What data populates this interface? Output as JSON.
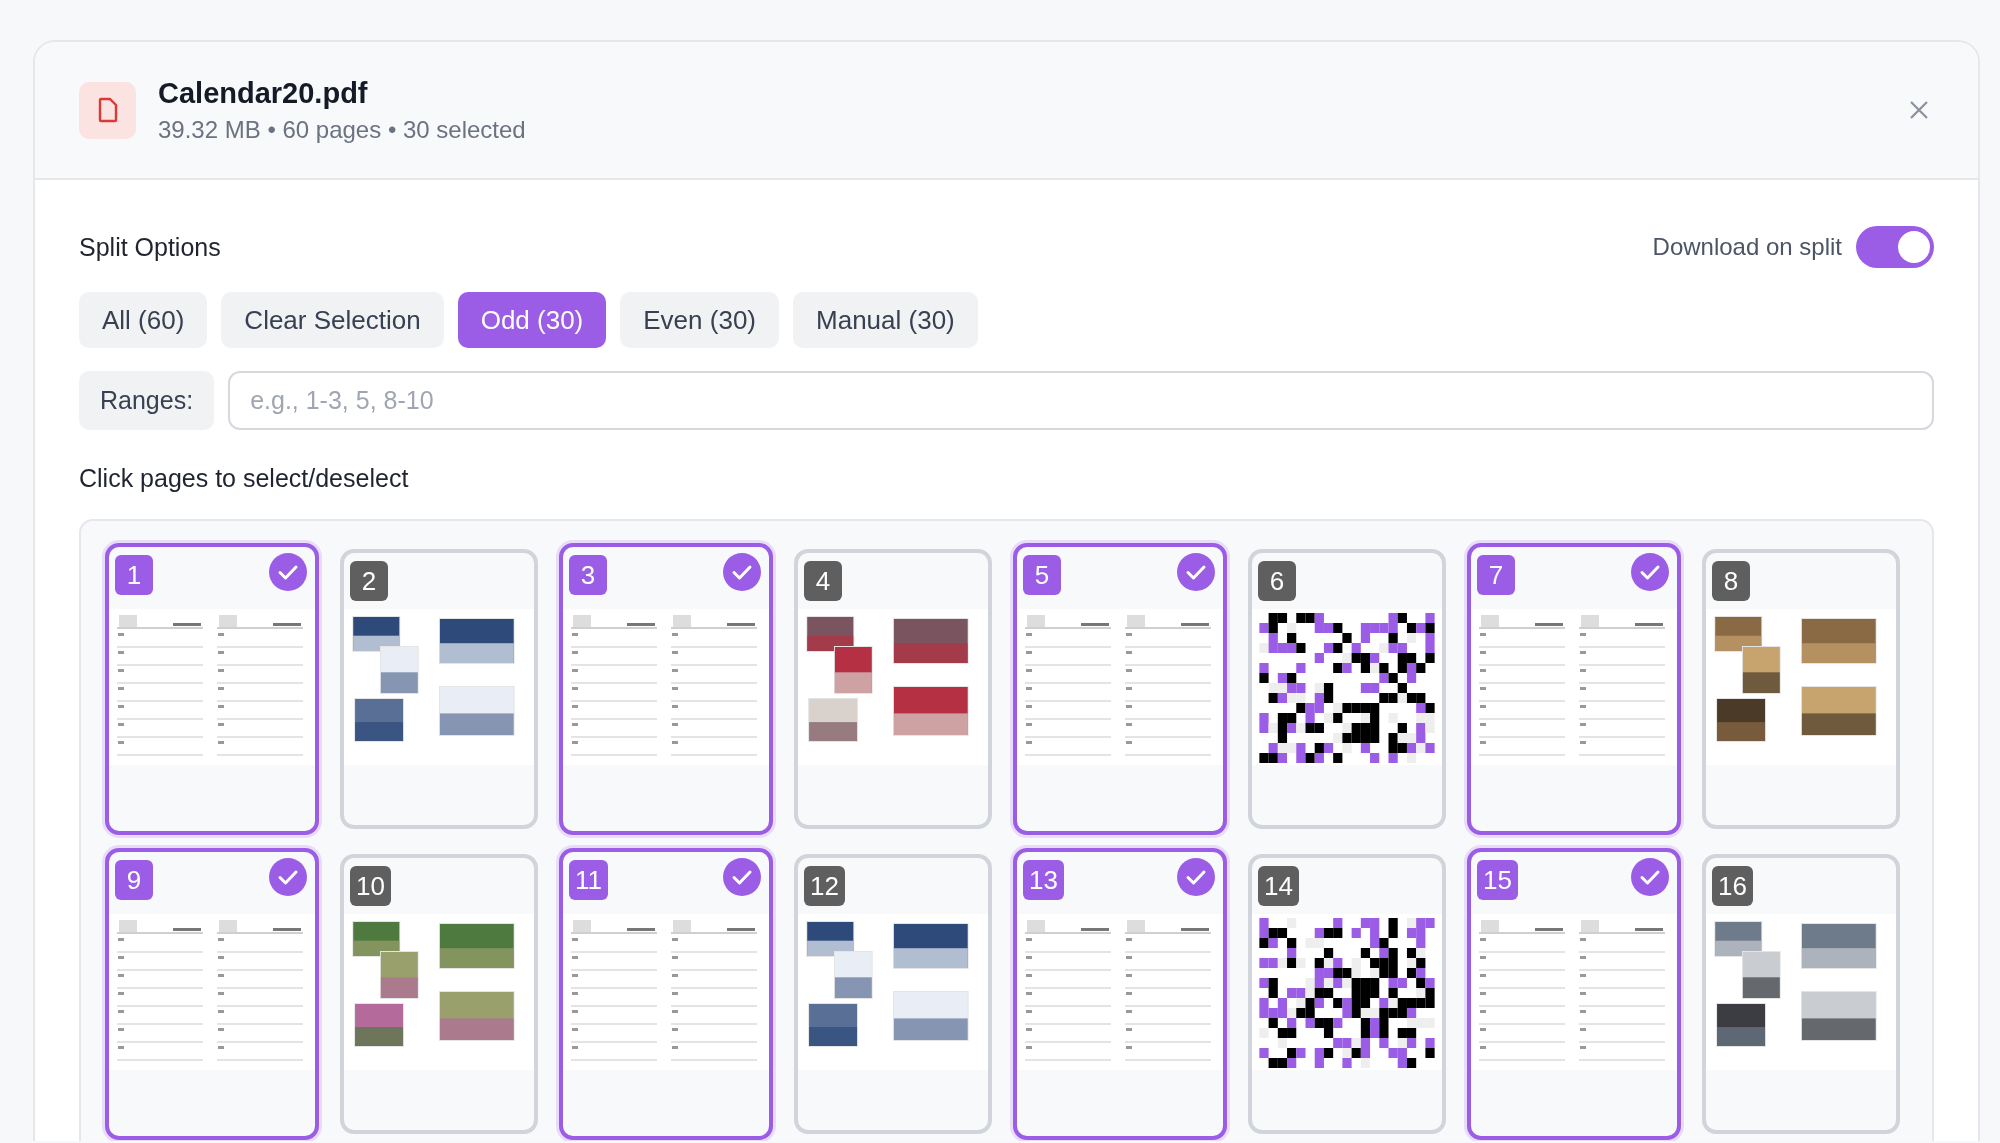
{
  "file": {
    "name": "Calendar20.pdf",
    "meta": "39.32 MB • 60 pages • 30 selected"
  },
  "split_options": {
    "title": "Split Options",
    "download_toggle": {
      "label": "Download on split",
      "on": true
    },
    "modes": [
      {
        "label": "All (60)",
        "selected": false
      },
      {
        "label": "Clear Selection",
        "selected": false
      },
      {
        "label": "Odd (30)",
        "selected": true
      },
      {
        "label": "Even (30)",
        "selected": false
      },
      {
        "label": "Manual (30)",
        "selected": false
      }
    ],
    "ranges": {
      "label": "Ranges:",
      "placeholder": "e.g., 1-3, 5, 8-10"
    }
  },
  "hint": "Click pages to select/deselect",
  "pages": [
    {
      "number": "1",
      "selected": true,
      "kind": "calendar"
    },
    {
      "number": "2",
      "selected": false,
      "kind": "photos"
    },
    {
      "number": "3",
      "selected": true,
      "kind": "calendar"
    },
    {
      "number": "4",
      "selected": false,
      "kind": "photos"
    },
    {
      "number": "5",
      "selected": true,
      "kind": "calendar"
    },
    {
      "number": "6",
      "selected": false,
      "kind": "pattern"
    },
    {
      "number": "7",
      "selected": true,
      "kind": "calendar"
    },
    {
      "number": "8",
      "selected": false,
      "kind": "photos"
    },
    {
      "number": "9",
      "selected": true,
      "kind": "calendar"
    },
    {
      "number": "10",
      "selected": false,
      "kind": "photos"
    },
    {
      "number": "11",
      "selected": true,
      "kind": "calendar"
    },
    {
      "number": "12",
      "selected": false,
      "kind": "photos"
    },
    {
      "number": "13",
      "selected": true,
      "kind": "calendar"
    },
    {
      "number": "14",
      "selected": false,
      "kind": "pattern"
    },
    {
      "number": "15",
      "selected": true,
      "kind": "calendar"
    },
    {
      "number": "16",
      "selected": false,
      "kind": "photos"
    }
  ]
}
